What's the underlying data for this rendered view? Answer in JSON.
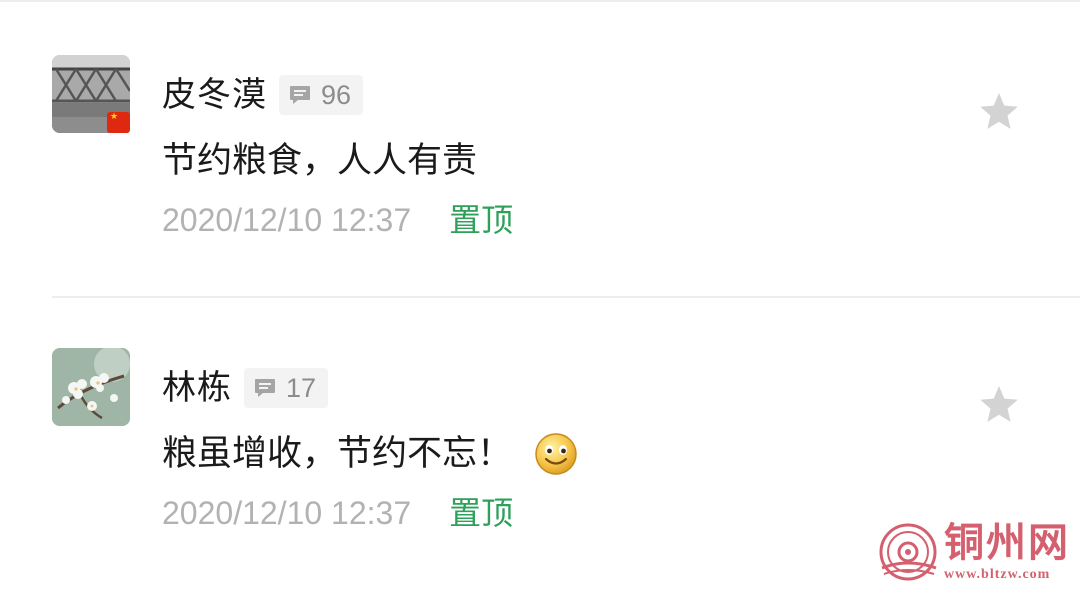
{
  "comments": [
    {
      "author": "皮冬漠",
      "reply_count": "96",
      "text": "节约粮食，人人有责",
      "timestamp": "2020/12/10 12:37",
      "pin_label": "置顶",
      "avatar_icon": "bridge-photo-avatar",
      "badge_icon": "china-flag-icon",
      "has_emoji": false
    },
    {
      "author": "林栋",
      "reply_count": "17",
      "text": "粮虽增收，节约不忘！",
      "timestamp": "2020/12/10 12:37",
      "pin_label": "置顶",
      "avatar_icon": "flower-photo-avatar",
      "emoji_icon": "smile-emoji-icon",
      "has_emoji": true
    }
  ],
  "watermark": {
    "title": "铜州网",
    "url": "www.bltzw.com"
  },
  "colors": {
    "pin": "#2fa05a",
    "timestamp": "#b2b2b2",
    "reply_count": "#8c8c8c",
    "star": "#d3d3d3",
    "watermark": "#d4606f",
    "divider": "#ededed"
  }
}
